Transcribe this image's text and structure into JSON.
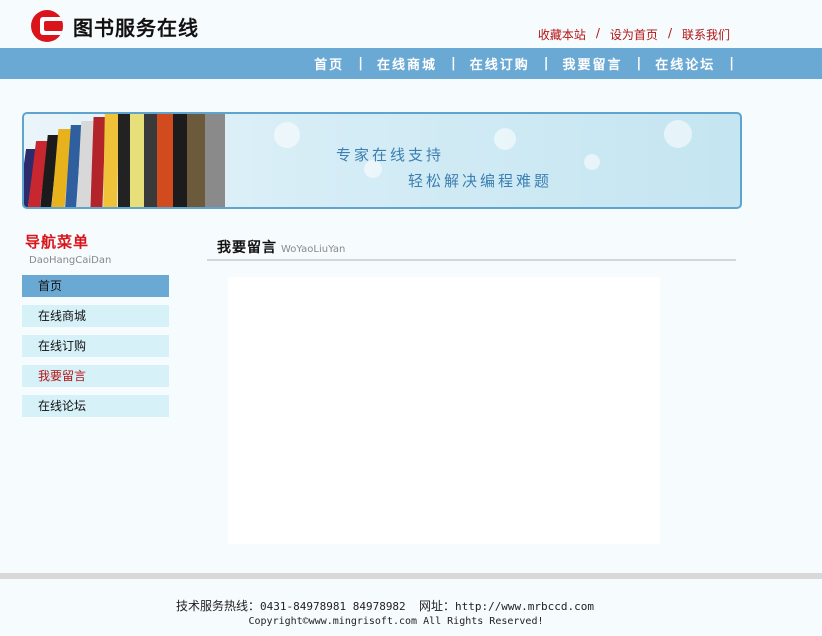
{
  "site": {
    "title": "图书服务在线"
  },
  "toplinks": {
    "bookmark": "收藏本站",
    "homepage": "设为首页",
    "contact": "联系我们",
    "separator": "/"
  },
  "nav": {
    "separator": "|",
    "items": [
      {
        "label": "首页"
      },
      {
        "label": "在线商城"
      },
      {
        "label": "在线订购"
      },
      {
        "label": "我要留言"
      },
      {
        "label": "在线论坛"
      }
    ]
  },
  "banner": {
    "line1": "专家在线支持",
    "line2": "轻松解决编程难题"
  },
  "sidebar": {
    "heading": "导航菜单",
    "heading_pinyin": "DaoHangCaiDan",
    "items": [
      {
        "label": "首页"
      },
      {
        "label": "在线商城"
      },
      {
        "label": "在线订购"
      },
      {
        "label": "我要留言"
      },
      {
        "label": "在线论坛"
      }
    ]
  },
  "content": {
    "title": "我要留言",
    "title_pinyin": "WoYaoLiuYan"
  },
  "footer": {
    "hotline_label": "技术服务热线：",
    "hotline_numbers": "0431-84978981  84978982",
    "url_label": "网址：",
    "url": "http://www.mrbccd.com",
    "copyright": "Copyright©www.mingrisoft.com All Rights Reserved!"
  },
  "colors": {
    "accent_red": "#d9141b",
    "nav_blue": "#6aa9d4",
    "menu_light": "#d7f1f8"
  }
}
